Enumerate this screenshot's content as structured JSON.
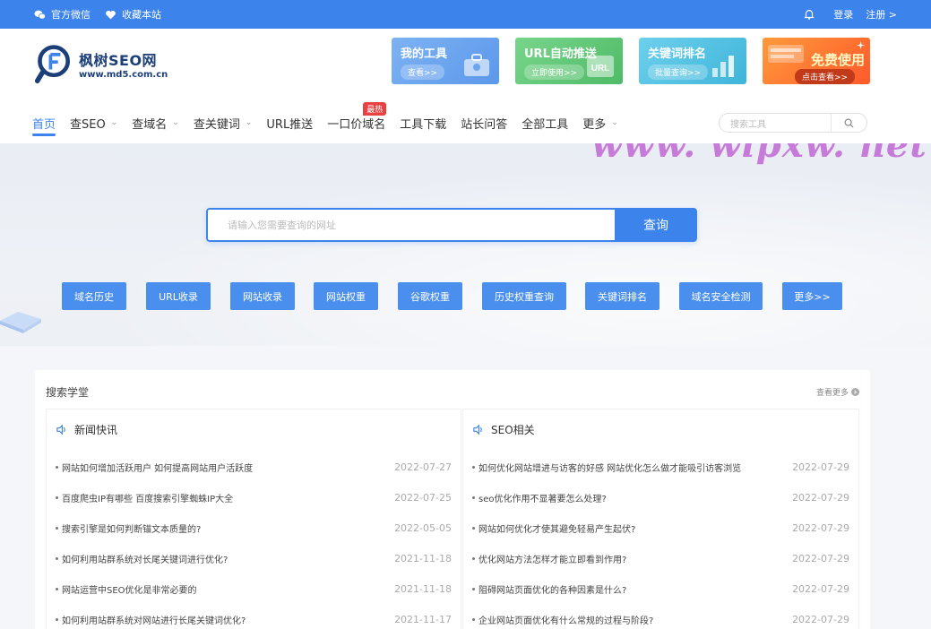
{
  "topbar": {
    "wechat": "官方微信",
    "favorite": "收藏本站",
    "login": "登录",
    "register": "注册 >"
  },
  "logo": {
    "name": "枫树SEO网",
    "domain": "www.md5.com.cn"
  },
  "promos": [
    {
      "title": "我的工具",
      "btn": "查看>>",
      "color": "#6ba5ee",
      "icon": "toolbox-icon"
    },
    {
      "title": "URL自动推送",
      "btn": "立即使用>>",
      "color": "#61c776",
      "icon": "url-icon"
    },
    {
      "title": "关键词排名",
      "btn": "批量查询>>",
      "color": "#4ec0e0",
      "icon": "bar-chart-icon"
    },
    {
      "title": "免费使用",
      "btn": "点击查看>>",
      "color": "#ff7b2e",
      "icon": "star-icon"
    }
  ],
  "nav": {
    "items": [
      "首页",
      "查SEO",
      "查域名",
      "查关键词",
      "URL推送",
      "一口价域名",
      "工具下载",
      "站长问答",
      "全部工具",
      "更多"
    ],
    "hot_badge": "最热",
    "search_placeholder": "搜索工具"
  },
  "watermark": "www. wlpxw. net",
  "hero": {
    "search_placeholder": "请输入您需要查询的网址",
    "search_button": "查询",
    "quick_links": [
      "域名历史",
      "URL收录",
      "网站收录",
      "网站权重",
      "谷歌权重",
      "历史权重查询",
      "关键词排名",
      "域名安全检测",
      "更多>>"
    ]
  },
  "panel": {
    "title": "搜索学堂",
    "more": "查看更多",
    "columns": [
      {
        "title": "新闻快讯",
        "rows": [
          {
            "text": "网站如何增加活跃用户 如何提高网站用户活跃度",
            "date": "2022-07-27"
          },
          {
            "text": "百度爬虫IP有哪些 百度搜索引擎蜘蛛IP大全",
            "date": "2022-07-25"
          },
          {
            "text": "搜索引擎是如何判断锚文本质量的?",
            "date": "2022-05-05"
          },
          {
            "text": "如何利用站群系统对长尾关键词进行优化?",
            "date": "2021-11-18"
          },
          {
            "text": "网站运营中SEO优化是非常必要的",
            "date": "2021-11-18"
          },
          {
            "text": "如何利用站群系统对网站进行长尾关键词优化?",
            "date": "2021-11-17"
          }
        ]
      },
      {
        "title": "SEO相关",
        "rows": [
          {
            "text": "如何优化网站增进与访客的好感 网站优化怎么做才能吸引访客浏览",
            "date": "2022-07-29"
          },
          {
            "text": "seo优化作用不显著要怎么处理?",
            "date": "2022-07-29"
          },
          {
            "text": "网站如何优化才使其避免轻易产生起伏?",
            "date": "2022-07-29"
          },
          {
            "text": "优化网站方法怎样才能立即看到作用?",
            "date": "2022-07-29"
          },
          {
            "text": "阻碍网站页面优化的各种因素是什么?",
            "date": "2022-07-29"
          },
          {
            "text": "企业网站页面优化有什么常规的过程与阶段?",
            "date": "2022-07-29"
          }
        ]
      }
    ]
  }
}
